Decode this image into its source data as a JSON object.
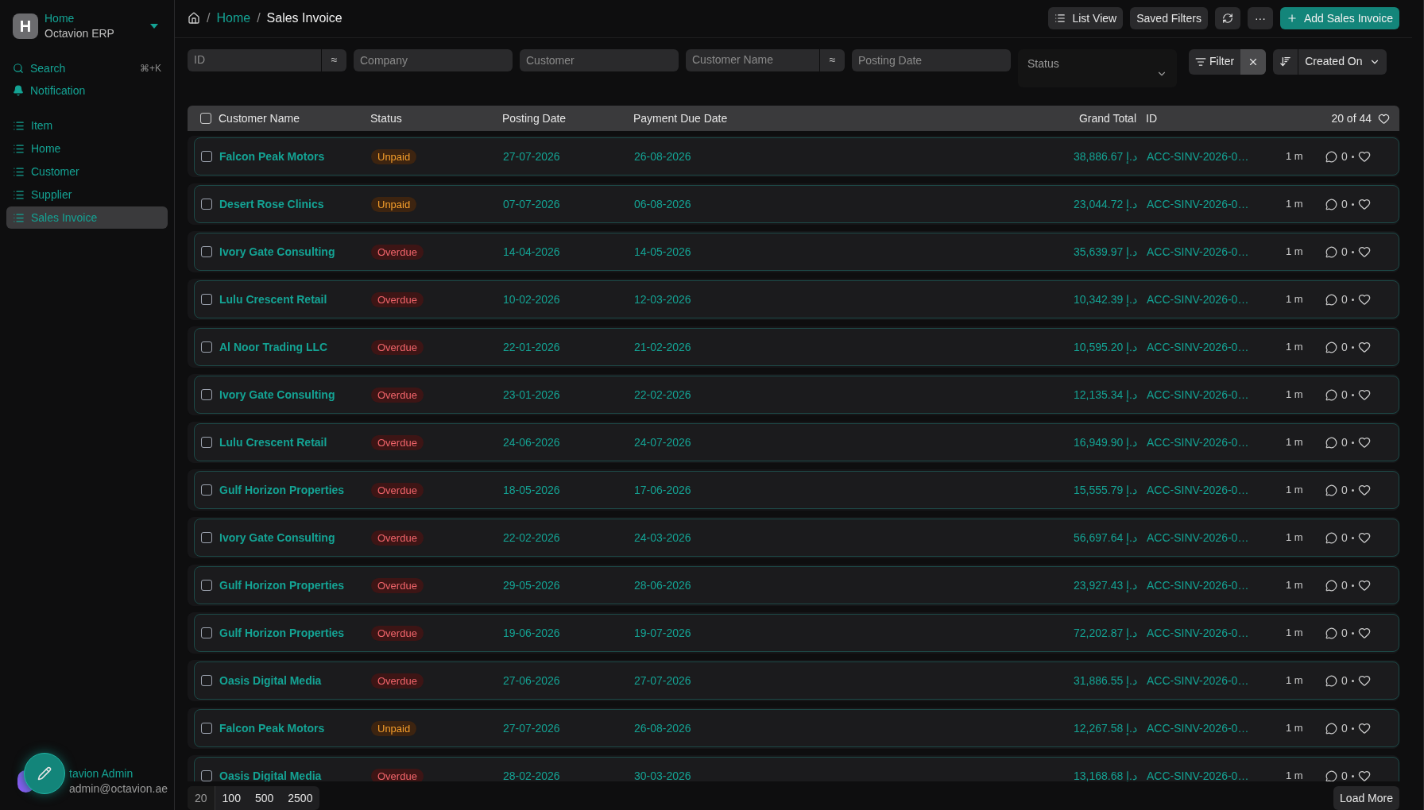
{
  "sidebar": {
    "workspace": {
      "initial": "H",
      "title": "Home",
      "subtitle": "Octavion ERP"
    },
    "search": {
      "label": "Search",
      "shortcut": "⌘+K"
    },
    "notification": {
      "label": "Notification"
    },
    "items": [
      {
        "label": "Item",
        "selected": false
      },
      {
        "label": "Home",
        "selected": false
      },
      {
        "label": "Customer",
        "selected": false
      },
      {
        "label": "Supplier",
        "selected": false
      },
      {
        "label": "Sales Invoice",
        "selected": true
      }
    ],
    "user": {
      "name": "tavion Admin",
      "email": "admin@octavion.ae"
    }
  },
  "breadcrumb": [
    {
      "text": "/",
      "kind": "separator"
    },
    {
      "text": "Home",
      "kind": "link"
    },
    {
      "text": "/",
      "kind": "separator"
    },
    {
      "text": "Sales Invoice",
      "kind": "current"
    }
  ],
  "toolbar": {
    "list_view": "List View",
    "saved_filters": "Saved Filters",
    "more": "···",
    "add": "Add Sales Invoice"
  },
  "filters": [
    {
      "placeholder": "ID",
      "kind": "like",
      "operator": "≈"
    },
    {
      "placeholder": "Company",
      "kind": "text"
    },
    {
      "placeholder": "Customer",
      "kind": "text"
    },
    {
      "placeholder": "Customer Name",
      "kind": "like",
      "operator": "≈"
    },
    {
      "placeholder": "Posting Date",
      "kind": "text"
    },
    {
      "placeholder": "Status",
      "kind": "select"
    }
  ],
  "filter_button": "Filter",
  "sort": "Created On",
  "table": {
    "select_all_checked": false,
    "columns": [
      "Customer Name",
      "Status",
      "Posting Date",
      "Payment Due Date",
      "Grand Total",
      "ID"
    ],
    "count": "20 of 44",
    "rows": [
      {
        "checked": false,
        "customer": "Falcon Peak Motors",
        "status": "Unpaid",
        "kind": "unpaid",
        "posting": "27-07-2026",
        "due": "26-08-2026",
        "total": "38,886.67",
        "currency": "د.إ",
        "id": "ACC-SINV-2026-0…",
        "time": "1 m",
        "comments": "0"
      },
      {
        "checked": false,
        "customer": "Desert Rose Clinics",
        "status": "Unpaid",
        "kind": "unpaid",
        "posting": "07-07-2026",
        "due": "06-08-2026",
        "total": "23,044.72",
        "currency": "د.إ",
        "id": "ACC-SINV-2026-0…",
        "time": "1 m",
        "comments": "0"
      },
      {
        "checked": false,
        "customer": "Ivory Gate Consulting",
        "status": "Overdue",
        "kind": "overdue",
        "posting": "14-04-2026",
        "due": "14-05-2026",
        "total": "35,639.97",
        "currency": "د.إ",
        "id": "ACC-SINV-2026-0…",
        "time": "1 m",
        "comments": "0"
      },
      {
        "checked": false,
        "customer": "Lulu Crescent Retail",
        "status": "Overdue",
        "kind": "overdue",
        "posting": "10-02-2026",
        "due": "12-03-2026",
        "total": "10,342.39",
        "currency": "د.إ",
        "id": "ACC-SINV-2026-0…",
        "time": "1 m",
        "comments": "0"
      },
      {
        "checked": false,
        "customer": "Al Noor Trading LLC",
        "status": "Overdue",
        "kind": "overdue",
        "posting": "22-01-2026",
        "due": "21-02-2026",
        "total": "10,595.20",
        "currency": "د.إ",
        "id": "ACC-SINV-2026-0…",
        "time": "1 m",
        "comments": "0"
      },
      {
        "checked": false,
        "customer": "Ivory Gate Consulting",
        "status": "Overdue",
        "kind": "overdue",
        "posting": "23-01-2026",
        "due": "22-02-2026",
        "total": "12,135.34",
        "currency": "د.إ",
        "id": "ACC-SINV-2026-0…",
        "time": "1 m",
        "comments": "0"
      },
      {
        "checked": false,
        "customer": "Lulu Crescent Retail",
        "status": "Overdue",
        "kind": "overdue",
        "posting": "24-06-2026",
        "due": "24-07-2026",
        "total": "16,949.90",
        "currency": "د.إ",
        "id": "ACC-SINV-2026-0…",
        "time": "1 m",
        "comments": "0"
      },
      {
        "checked": false,
        "customer": "Gulf Horizon Properties",
        "status": "Overdue",
        "kind": "overdue",
        "posting": "18-05-2026",
        "due": "17-06-2026",
        "total": "15,555.79",
        "currency": "د.إ",
        "id": "ACC-SINV-2026-0…",
        "time": "1 m",
        "comments": "0"
      },
      {
        "checked": false,
        "customer": "Ivory Gate Consulting",
        "status": "Overdue",
        "kind": "overdue",
        "posting": "22-02-2026",
        "due": "24-03-2026",
        "total": "56,697.64",
        "currency": "د.إ",
        "id": "ACC-SINV-2026-0…",
        "time": "1 m",
        "comments": "0"
      },
      {
        "checked": false,
        "customer": "Gulf Horizon Properties",
        "status": "Overdue",
        "kind": "overdue",
        "posting": "29-05-2026",
        "due": "28-06-2026",
        "total": "23,927.43",
        "currency": "د.إ",
        "id": "ACC-SINV-2026-0…",
        "time": "1 m",
        "comments": "0"
      },
      {
        "checked": false,
        "customer": "Gulf Horizon Properties",
        "status": "Overdue",
        "kind": "overdue",
        "posting": "19-06-2026",
        "due": "19-07-2026",
        "total": "72,202.87",
        "currency": "د.إ",
        "id": "ACC-SINV-2026-0…",
        "time": "1 m",
        "comments": "0"
      },
      {
        "checked": false,
        "customer": "Oasis Digital Media",
        "status": "Overdue",
        "kind": "overdue",
        "posting": "27-06-2026",
        "due": "27-07-2026",
        "total": "31,886.55",
        "currency": "د.إ",
        "id": "ACC-SINV-2026-0…",
        "time": "1 m",
        "comments": "0"
      },
      {
        "checked": false,
        "customer": "Falcon Peak Motors",
        "status": "Unpaid",
        "kind": "unpaid",
        "posting": "27-07-2026",
        "due": "26-08-2026",
        "total": "12,267.58",
        "currency": "د.إ",
        "id": "ACC-SINV-2026-0…",
        "time": "1 m",
        "comments": "0"
      },
      {
        "checked": false,
        "customer": "Oasis Digital Media",
        "status": "Overdue",
        "kind": "overdue",
        "posting": "28-02-2026",
        "due": "30-03-2026",
        "total": "13,168.68",
        "currency": "د.إ",
        "id": "ACC-SINV-2026-0…",
        "time": "1 m",
        "comments": "0"
      }
    ]
  },
  "page_sizes": [
    {
      "label": "20",
      "selected": true
    },
    {
      "label": "100",
      "selected": false
    },
    {
      "label": "500",
      "selected": false
    },
    {
      "label": "2500",
      "selected": false
    }
  ],
  "load_more": "Load More"
}
